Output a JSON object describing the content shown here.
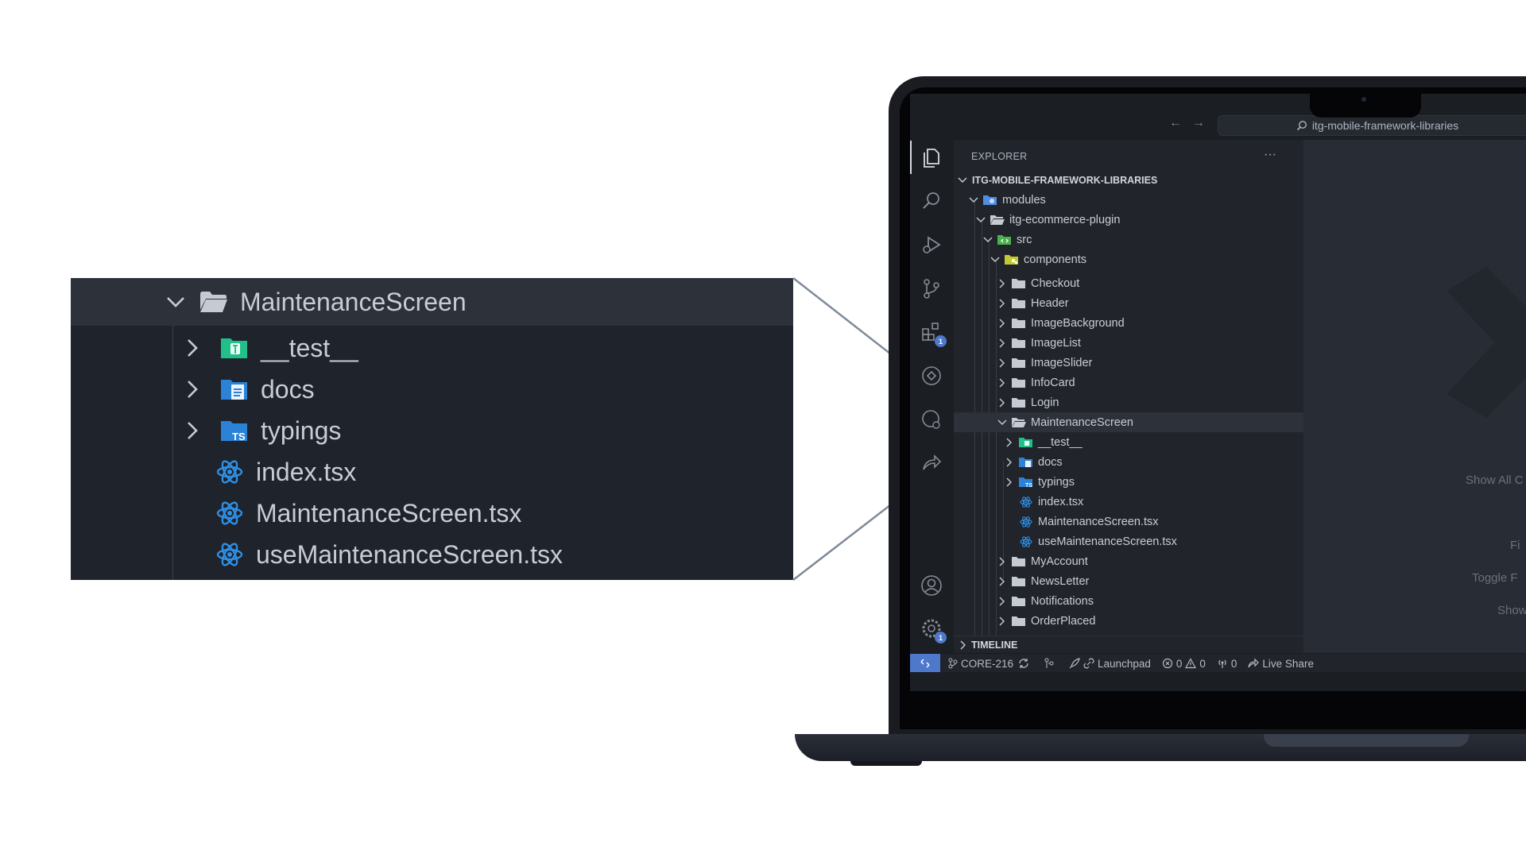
{
  "colors": {
    "accent": "#4d78cc",
    "folder": "#c5cad3",
    "react_icon": "#2f8fe4",
    "test_folder": "#21c08b",
    "docs_folder": "#2b83d8",
    "typings_folder": "#2b83d8"
  },
  "callout": {
    "parent": {
      "label": "MaintenanceScreen",
      "icon": "folder-open-icon"
    },
    "children": [
      {
        "label": "__test__",
        "icon": "test-folder-icon",
        "expandable": true
      },
      {
        "label": "docs",
        "icon": "docs-folder-icon",
        "expandable": true
      },
      {
        "label": "typings",
        "icon": "typings-folder-icon",
        "expandable": true
      },
      {
        "label": "index.tsx",
        "icon": "react-icon",
        "expandable": false
      },
      {
        "label": "MaintenanceScreen.tsx",
        "icon": "react-icon",
        "expandable": false
      },
      {
        "label": "useMaintenanceScreen.tsx",
        "icon": "react-icon",
        "expandable": false
      }
    ]
  },
  "titlebar": {
    "search_text": "itg-mobile-framework-libraries"
  },
  "activity_bar": {
    "items": [
      "explorer-icon",
      "search-icon",
      "run-debug-icon",
      "source-control-icon",
      "extensions-icon",
      "remote-explorer-icon",
      "github-icon",
      "live-share-icon"
    ],
    "extensions_badge": "1",
    "settings_badge": "1"
  },
  "explorer": {
    "title": "EXPLORER",
    "more": "···",
    "root": "ITG-MOBILE-FRAMEWORK-LIBRARIES",
    "tree": [
      {
        "label": "modules",
        "depth": 1,
        "type": "special-folder-open"
      },
      {
        "label": "itg-ecommerce-plugin",
        "depth": 2,
        "type": "folder-open"
      },
      {
        "label": "src",
        "depth": 3,
        "type": "src-folder-open"
      },
      {
        "label": "components",
        "depth": 4,
        "type": "components-folder-open"
      },
      {
        "label": "Checkout",
        "depth": 5,
        "type": "folder"
      },
      {
        "label": "Header",
        "depth": 5,
        "type": "folder"
      },
      {
        "label": "ImageBackground",
        "depth": 5,
        "type": "folder"
      },
      {
        "label": "ImageList",
        "depth": 5,
        "type": "folder"
      },
      {
        "label": "ImageSlider",
        "depth": 5,
        "type": "folder"
      },
      {
        "label": "InfoCard",
        "depth": 5,
        "type": "folder"
      },
      {
        "label": "Login",
        "depth": 5,
        "type": "folder"
      },
      {
        "label": "MaintenanceScreen",
        "depth": 5,
        "type": "folder-open"
      },
      {
        "label": "__test__",
        "depth": 6,
        "type": "test-folder"
      },
      {
        "label": "docs",
        "depth": 6,
        "type": "docs-folder"
      },
      {
        "label": "typings",
        "depth": 6,
        "type": "typings-folder"
      },
      {
        "label": "index.tsx",
        "depth": 6,
        "type": "react"
      },
      {
        "label": "MaintenanceScreen.tsx",
        "depth": 6,
        "type": "react"
      },
      {
        "label": "useMaintenanceScreen.tsx",
        "depth": 6,
        "type": "react"
      },
      {
        "label": "MyAccount",
        "depth": 5,
        "type": "folder"
      },
      {
        "label": "NewsLetter",
        "depth": 5,
        "type": "folder"
      },
      {
        "label": "Notifications",
        "depth": 5,
        "type": "folder"
      },
      {
        "label": "OrderPlaced",
        "depth": 5,
        "type": "folder"
      }
    ],
    "timeline": "TIMELINE"
  },
  "editor_hints": [
    "Show All C",
    "Fi",
    "Toggle F",
    "Show"
  ],
  "statusbar": {
    "branch": "CORE-216",
    "launchpad": "Launchpad",
    "errors": "0",
    "warnings": "0",
    "ports": "0",
    "live_share": "Live Share"
  }
}
